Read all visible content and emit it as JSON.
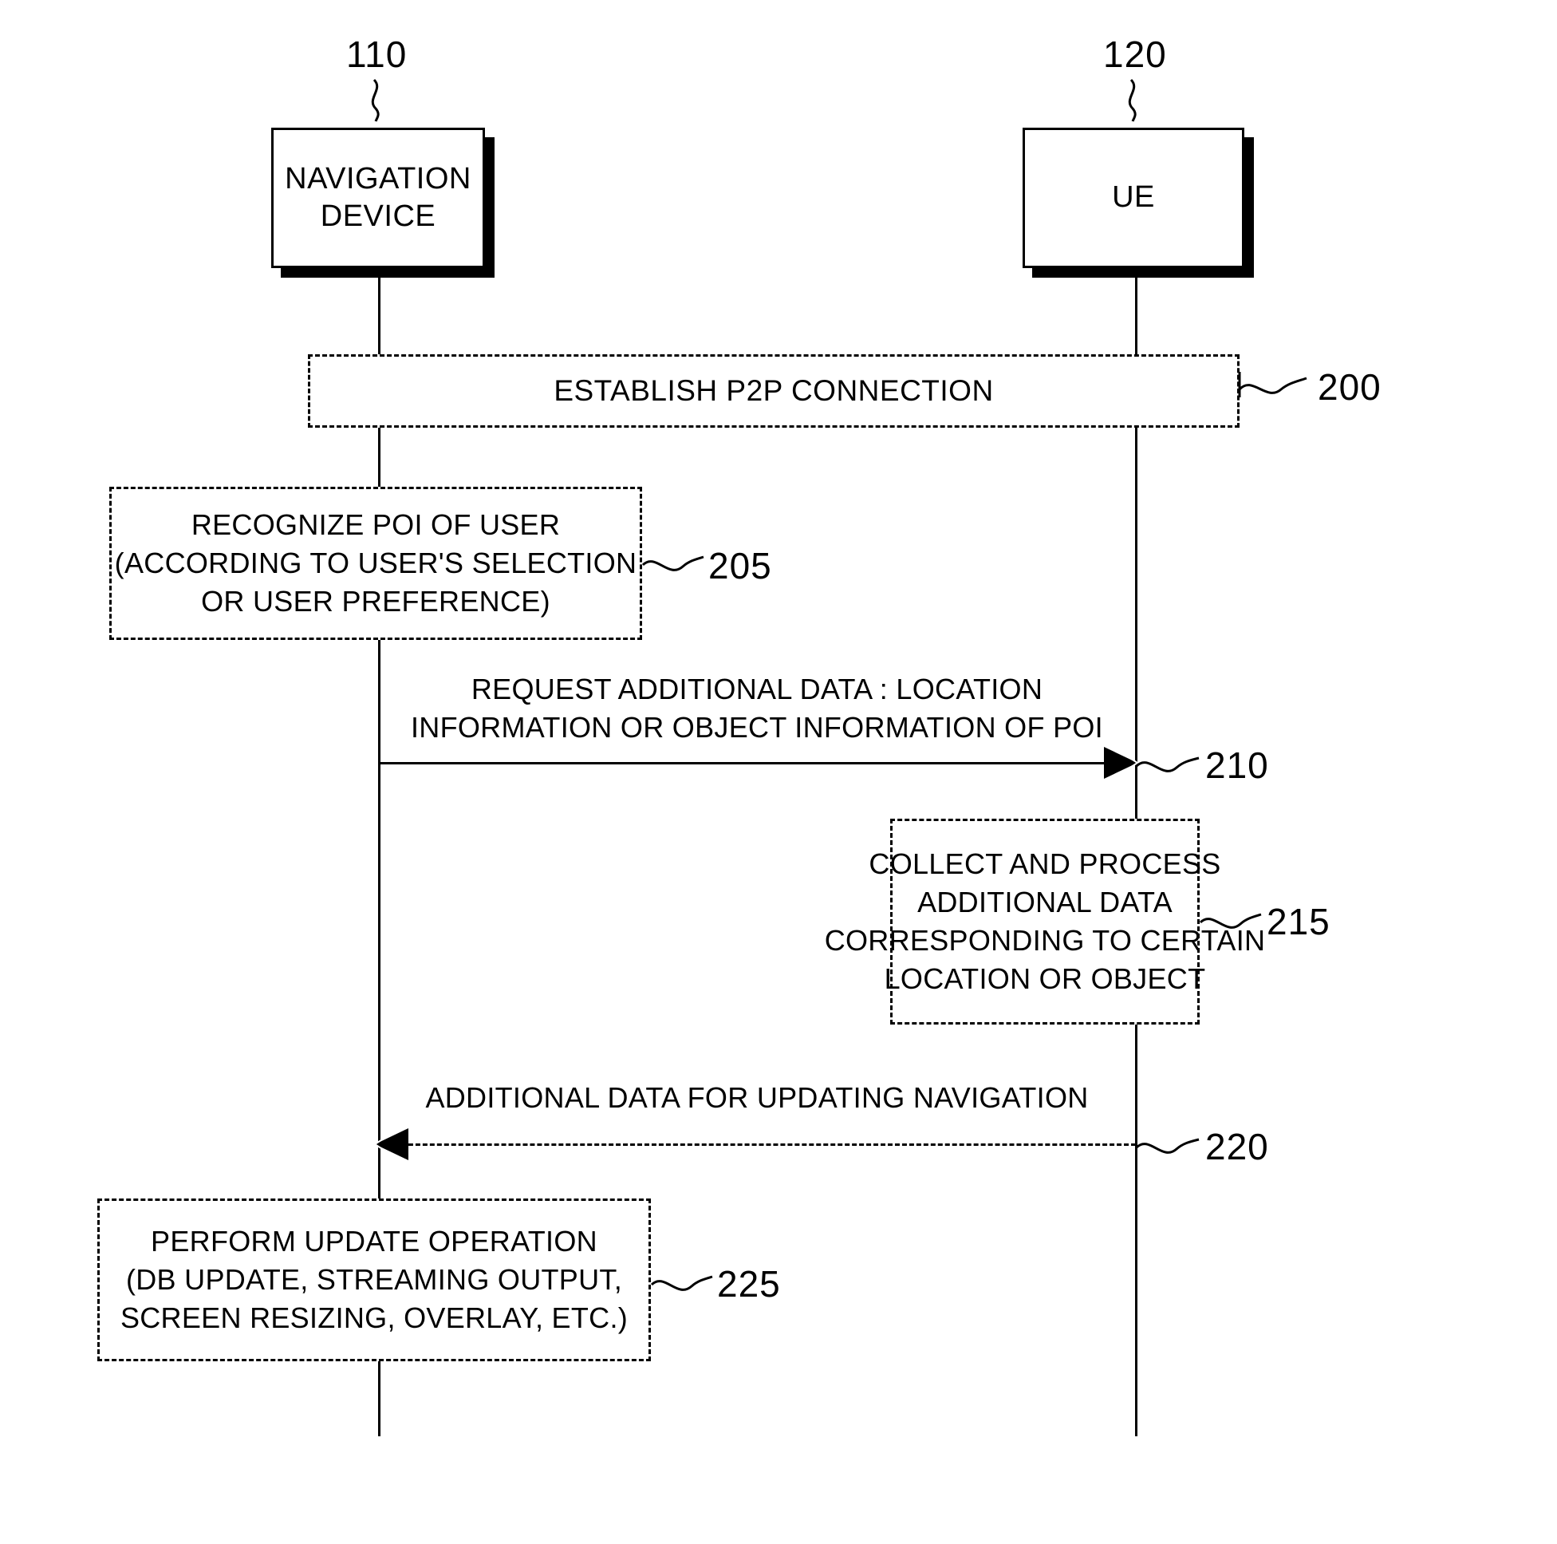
{
  "figure": {
    "type": "patent-sequence-diagram",
    "background_color": "#ffffff",
    "line_color": "#000000"
  },
  "entities": [
    {
      "ref": "110",
      "label_line1": "NAVIGATION",
      "label_line2": "DEVICE"
    },
    {
      "ref": "120",
      "label_line1": "UE",
      "label_line2": ""
    }
  ],
  "steps": [
    {
      "ref": "200",
      "kind": "band",
      "lines": [
        "ESTABLISH P2P CONNECTION"
      ]
    },
    {
      "ref": "205",
      "kind": "process",
      "owner": "110",
      "lines": [
        "RECOGNIZE POI OF USER",
        "(ACCORDING TO USER'S SELECTION",
        "OR USER PREFERENCE)"
      ]
    },
    {
      "ref": "210",
      "kind": "message",
      "direction": "right",
      "style": "solid",
      "lines": [
        "REQUEST ADDITIONAL DATA : LOCATION",
        "INFORMATION OR OBJECT INFORMATION OF POI"
      ]
    },
    {
      "ref": "215",
      "kind": "process",
      "owner": "120",
      "lines": [
        "COLLECT AND PROCESS",
        "ADDITIONAL DATA",
        "CORRESPONDING TO CERTAIN",
        "LOCATION OR OBJECT"
      ]
    },
    {
      "ref": "220",
      "kind": "message",
      "direction": "left",
      "style": "dashed",
      "lines": [
        "ADDITIONAL DATA FOR UPDATING NAVIGATION"
      ]
    },
    {
      "ref": "225",
      "kind": "process",
      "owner": "110",
      "lines": [
        "PERFORM UPDATE OPERATION",
        "(DB UPDATE, STREAMING OUTPUT,",
        "SCREEN RESIZING, OVERLAY, ETC.)"
      ]
    }
  ]
}
